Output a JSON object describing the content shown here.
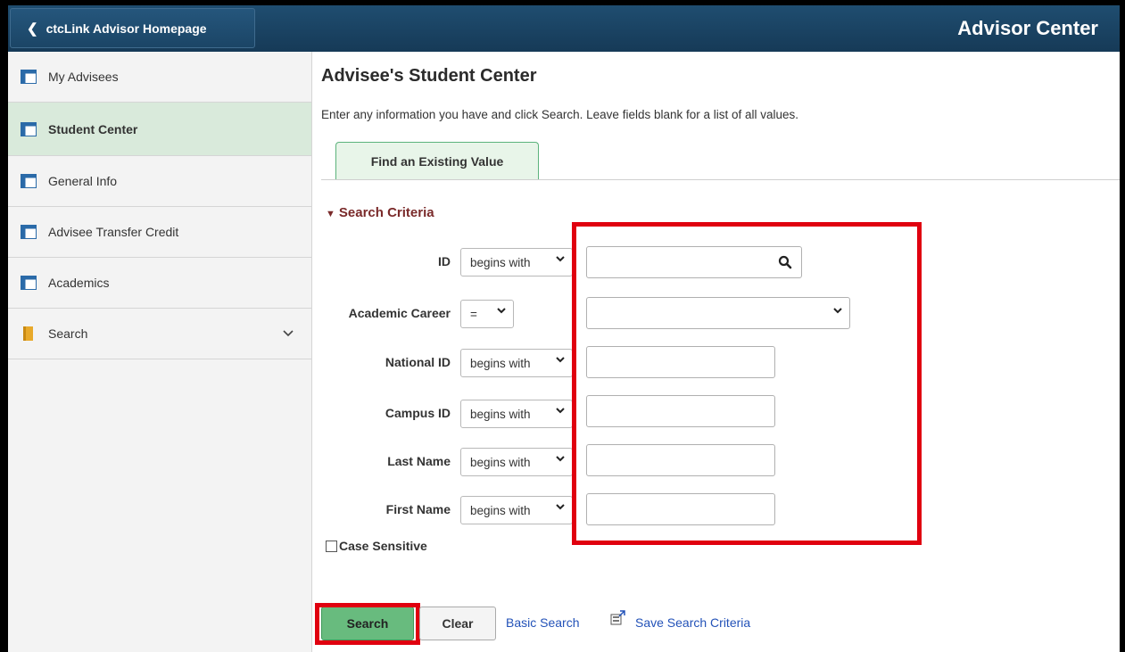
{
  "header": {
    "back_label": "ctcLink Advisor Homepage",
    "title": "Advisor Center"
  },
  "sidebar": {
    "items": [
      {
        "label": "My Advisees",
        "icon": "grid-page-icon"
      },
      {
        "label": "Student Center",
        "icon": "grid-page-icon",
        "active": true
      },
      {
        "label": "General Info",
        "icon": "grid-page-icon"
      },
      {
        "label": "Advisee Transfer Credit",
        "icon": "grid-page-icon"
      },
      {
        "label": "Academics",
        "icon": "grid-page-icon"
      },
      {
        "label": "Search",
        "icon": "folder-icon",
        "expandable": true
      }
    ]
  },
  "main": {
    "title": "Advisee's Student Center",
    "instructions": "Enter any information you have and click Search. Leave fields blank for a list of all values.",
    "tab_label": "Find an Existing Value",
    "criteria_heading": "Search Criteria",
    "fields": [
      {
        "label": "ID",
        "operator": "begins with",
        "value": "",
        "type": "prompt"
      },
      {
        "label": "Academic Career",
        "operator": "=",
        "value": "",
        "type": "select"
      },
      {
        "label": "National ID",
        "operator": "begins with",
        "value": "",
        "type": "text"
      },
      {
        "label": "Campus ID",
        "operator": "begins with",
        "value": "",
        "type": "text"
      },
      {
        "label": "Last Name",
        "operator": "begins with",
        "value": "",
        "type": "text"
      },
      {
        "label": "First Name",
        "operator": "begins with",
        "value": "",
        "type": "text"
      }
    ],
    "case_sensitive_label": "Case Sensitive",
    "buttons": {
      "search": "Search",
      "clear": "Clear"
    },
    "links": {
      "basic_search": "Basic Search",
      "save_criteria": "Save Search Criteria"
    }
  },
  "colors": {
    "header_bg": "#1b4566",
    "active_nav": "#d9eadb",
    "highlight": "#e0000f",
    "search_button": "#68bb7e",
    "link": "#2352b8"
  }
}
